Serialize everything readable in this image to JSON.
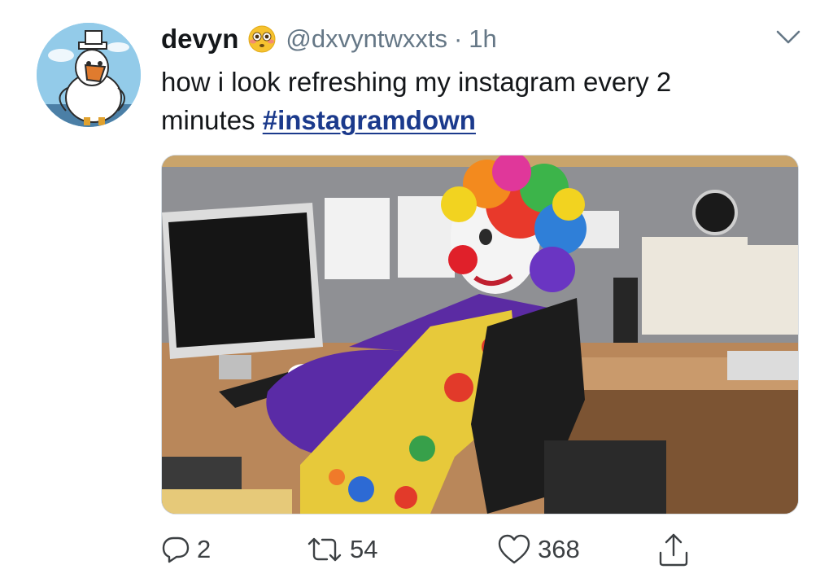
{
  "tweet": {
    "display_name": "devyn",
    "name_emoji": "flushed-face-emoji",
    "handle": "@dxvyntwxxts",
    "separator": "·",
    "time": "1h",
    "text_line1": "how i look refreshing my instagram every 2",
    "text_line2": "minutes",
    "hashtag": "#instagramdown",
    "media": "image",
    "replies": "2",
    "retweets": "54",
    "likes": "368"
  },
  "icons": {
    "menu": "chevron-down-icon",
    "reply": "reply-icon",
    "retweet": "retweet-icon",
    "like": "heart-icon",
    "share": "share-icon"
  },
  "colors": {
    "text": "#14171a",
    "secondary": "#657786",
    "hashtag": "#1b3a8c",
    "action_icon": "#3c4043"
  }
}
